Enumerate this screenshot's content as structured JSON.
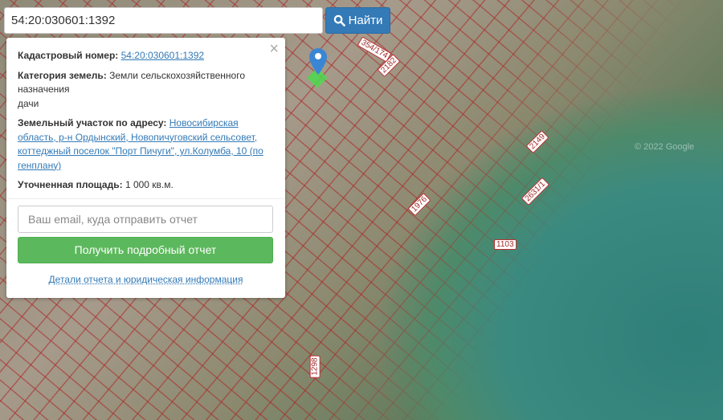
{
  "search": {
    "value": "54:20:030601:1392",
    "button_label": "Найти"
  },
  "info": {
    "cadastral_label": "Кадастровый номер:",
    "cadastral_value": "54:20:030601:1392",
    "category_label": "Категория земель:",
    "category_value": "Земли сельскохозяйственного назначения",
    "usage_value": "дачи",
    "address_label": "Земельный участок по адресу:",
    "address_value": "Новосибирская область, р-н Ордынский, Новопичуговский сельсовет, коттеджный поселок \"Порт Пичуги\", ул.Колумба, 10 (по генплану)",
    "area_label": "Уточненная площадь:",
    "area_value": "1 000 кв.м."
  },
  "report": {
    "email_placeholder": "Ваш email, куда отправить отчет",
    "button_label": "Получить подробный отчет",
    "details_link": "Детали отчета и юридическая информация"
  },
  "map": {
    "parcels": [
      "354/174",
      "2182",
      "1103",
      "2631/1",
      "2149",
      "1976",
      "1298"
    ],
    "attribution": "© 2022 Google"
  }
}
